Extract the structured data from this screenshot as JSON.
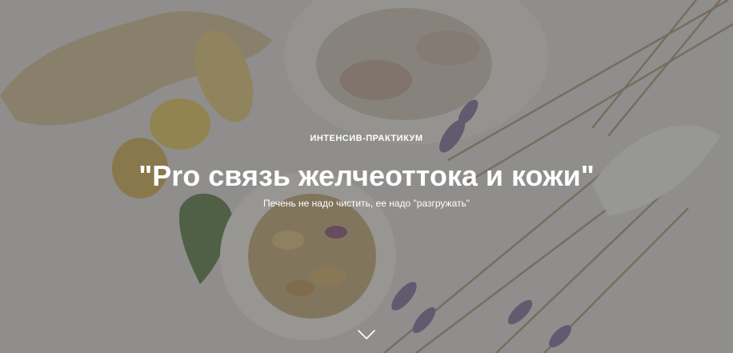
{
  "hero": {
    "eyebrow": "ИНТЕНСИВ-ПРАКТИКУМ",
    "title": "\"Pro связь желчеоттока и кожи\"",
    "subtitle": "Печень не надо чистить, ее надо \"разгружать\"",
    "scroll_icon": "chevron-down-icon",
    "overlay_color": "#282828"
  }
}
